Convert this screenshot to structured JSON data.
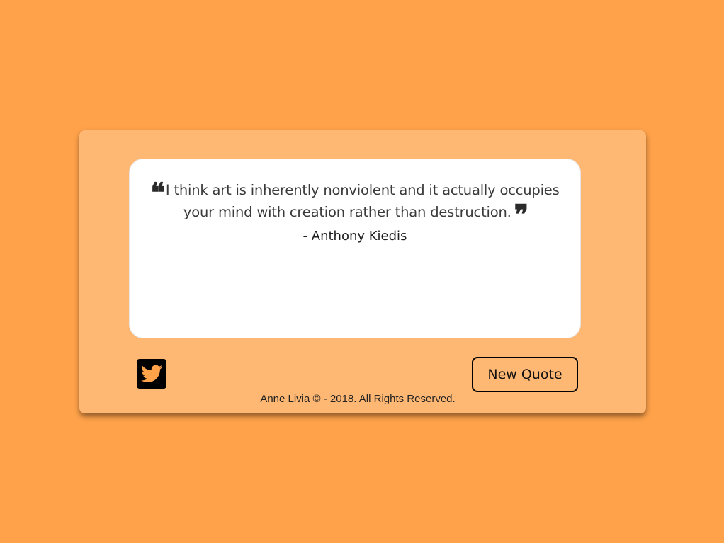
{
  "colors": {
    "page_background": "#ffa24a",
    "card_background": "#ffb873",
    "quote_box_background": "#ffffff",
    "twitter_button_background": "#000000",
    "twitter_icon_color": "#ffa24a"
  },
  "quote": {
    "open_mark": "❝",
    "text": "I think art is inherently nonviolent and it actually occupies your mind with creation rather than destruction.",
    "close_mark": "❞",
    "author": "- Anthony Kiedis"
  },
  "actions": {
    "tweet_icon": "twitter-icon",
    "new_quote_label": "New Quote"
  },
  "footer": {
    "text": "Anne Livia © - 2018. All Rights Reserved."
  }
}
